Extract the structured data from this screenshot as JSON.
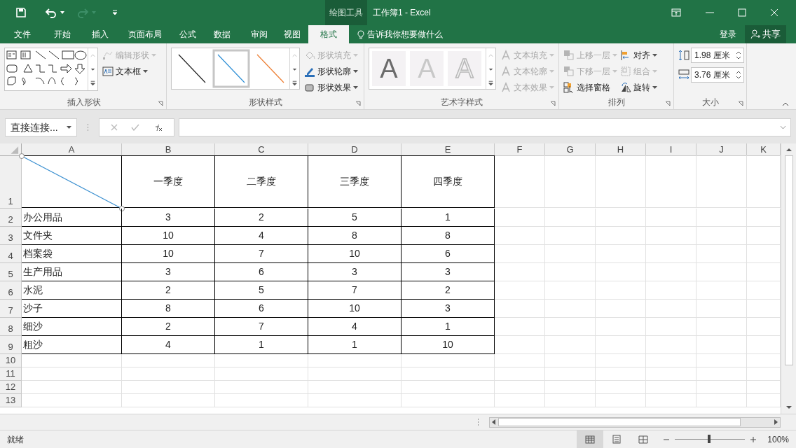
{
  "window": {
    "context_label": "绘图工具",
    "title": "工作簿1 - Excel"
  },
  "tabs": [
    {
      "label": "文件",
      "selected": false
    },
    {
      "label": "开始",
      "selected": false
    },
    {
      "label": "插入",
      "selected": false
    },
    {
      "label": "页面布局",
      "selected": false
    },
    {
      "label": "公式",
      "selected": false
    },
    {
      "label": "数据",
      "selected": false
    },
    {
      "label": "审阅",
      "selected": false
    },
    {
      "label": "视图",
      "selected": false
    },
    {
      "label": "格式",
      "selected": true
    }
  ],
  "tell_me": "告诉我你想要做什么",
  "sign_in": "登录",
  "share": "共享",
  "ribbon": {
    "insert_shapes": {
      "label": "插入形状",
      "commands": [
        {
          "label": "编辑形状",
          "disabled": true
        },
        {
          "label": "文本框",
          "disabled": false
        }
      ]
    },
    "shape_styles": {
      "label": "形状样式",
      "commands": [
        {
          "label": "形状填充",
          "disabled": true
        },
        {
          "label": "形状轮廓",
          "disabled": false
        },
        {
          "label": "形状效果",
          "disabled": false
        }
      ]
    },
    "wordart_styles": {
      "label": "艺术字样式",
      "samples": [
        {
          "text": "A",
          "kind": "solid"
        },
        {
          "text": "A",
          "kind": "light"
        },
        {
          "text": "A",
          "kind": "outline"
        }
      ],
      "commands": [
        {
          "label": "文本填充",
          "disabled": true
        },
        {
          "label": "文本轮廓",
          "disabled": true
        },
        {
          "label": "文本效果",
          "disabled": true
        }
      ]
    },
    "arrange": {
      "label": "排列",
      "commands": [
        {
          "label": "上移一层",
          "disabled": true
        },
        {
          "label": "对齐",
          "disabled": false
        },
        {
          "label": "下移一层",
          "disabled": true
        },
        {
          "label": "组合",
          "disabled": true
        },
        {
          "label": "选择窗格",
          "disabled": false
        },
        {
          "label": "旋转",
          "disabled": false
        }
      ]
    },
    "size": {
      "label": "大小",
      "height": "1.98 厘米",
      "width": "3.76 厘米"
    }
  },
  "name_box": "直接连接...",
  "columns": [
    "A",
    "B",
    "C",
    "D",
    "E",
    "F",
    "G",
    "H",
    "I",
    "J",
    "K"
  ],
  "rows": [
    {
      "header": "1",
      "cells": [
        "",
        "一季度",
        "二季度",
        "三季度",
        "四季度"
      ]
    },
    {
      "header": "2",
      "cells": [
        "办公用品",
        "3",
        "2",
        "5",
        "1"
      ]
    },
    {
      "header": "3",
      "cells": [
        "文件夹",
        "10",
        "4",
        "8",
        "8"
      ]
    },
    {
      "header": "4",
      "cells": [
        "档案袋",
        "10",
        "7",
        "10",
        "6"
      ]
    },
    {
      "header": "5",
      "cells": [
        "生产用品",
        "3",
        "6",
        "3",
        "3"
      ]
    },
    {
      "header": "6",
      "cells": [
        "水泥",
        "2",
        "5",
        "7",
        "2"
      ]
    },
    {
      "header": "7",
      "cells": [
        "沙子",
        "8",
        "6",
        "10",
        "3"
      ]
    },
    {
      "header": "8",
      "cells": [
        "细沙",
        "2",
        "7",
        "4",
        "1"
      ]
    },
    {
      "header": "9",
      "cells": [
        "粗沙",
        "4",
        "1",
        "1",
        "10"
      ]
    },
    {
      "header": "10",
      "cells": []
    },
    {
      "header": "11",
      "cells": []
    },
    {
      "header": "12",
      "cells": []
    },
    {
      "header": "13",
      "cells": []
    }
  ],
  "status": "就绪",
  "zoom": "100%"
}
